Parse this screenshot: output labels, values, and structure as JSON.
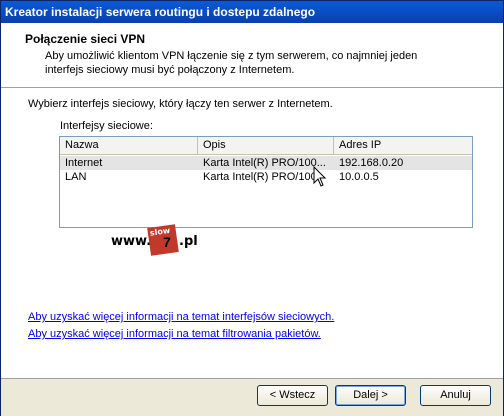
{
  "window": {
    "title": "Kreator instalacji serwera routingu i dostepu zdalnego"
  },
  "header": {
    "title": "Połączenie sieci VPN",
    "description": "Aby umożliwić klientom VPN łączenie się z tym serwerem, co najmniej jeden interfejs sieciowy musi być połączony z Internetem."
  },
  "body": {
    "prompt": "Wybierz interfejs sieciowy, który łączy ten serwer z Internetem.",
    "list_label": "Interfejsy sieciowe:",
    "columns": [
      "Nazwa",
      "Opis",
      "Adres IP"
    ],
    "rows": [
      {
        "name": "Internet",
        "description": "Karta Intel(R) PRO/100...",
        "ip": "192.168.0.20",
        "selected": true
      },
      {
        "name": "LAN",
        "description": "Karta Intel(R) PRO/100",
        "ip": "10.0.0.5",
        "selected": false
      }
    ]
  },
  "watermark": {
    "prefix": "www.",
    "box_text": "slow",
    "box_digit": "7",
    "suffix": ".pl"
  },
  "links": {
    "interfaces": "Aby uzyskać więcej informacji na temat interfejsów sieciowych.",
    "filtering": "Aby uzyskać więcej informacji na temat filtrowania pakietów."
  },
  "footer": {
    "back_label": "< Wstecz",
    "next_label": "Dalej >",
    "cancel_label": "Anuluj"
  },
  "colors": {
    "titlebar": "#0a3faf",
    "link": "#0000ee",
    "selection": "#e4e4e4"
  }
}
